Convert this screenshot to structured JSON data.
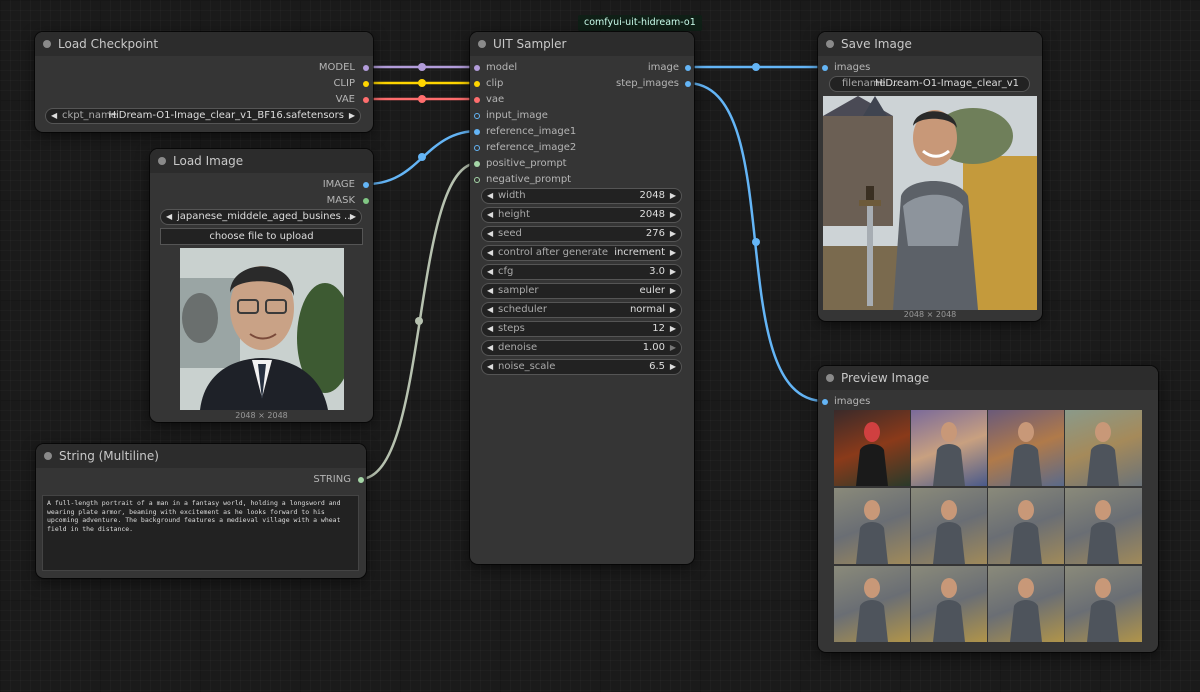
{
  "group": {
    "label": "comfyui-uit-hidream-o1"
  },
  "load_checkpoint": {
    "title": "Load Checkpoint",
    "outputs": [
      "MODEL",
      "CLIP",
      "VAE"
    ],
    "ckpt_label": "ckpt_name",
    "ckpt_value": "HiDream-O1-Image_clear_v1_BF16.safetensors"
  },
  "load_image": {
    "title": "Load Image",
    "outputs": [
      "IMAGE",
      "MASK"
    ],
    "file_value": "japanese_middele_aged_busines ...",
    "upload_label": "choose file to upload",
    "size_caption": "2048 × 2048"
  },
  "string_node": {
    "title": "String (Multiline)",
    "output": "STRING",
    "text": "A full-length portrait of a man in a fantasy world, holding a longsword and wearing plate armor, beaming with excitement as he looks forward to his upcoming adventure. The background features a medieval village with a wheat field in the distance."
  },
  "sampler": {
    "title": "UIT Sampler",
    "inputs": [
      "model",
      "clip",
      "vae",
      "input_image",
      "reference_image1",
      "reference_image2",
      "positive_prompt",
      "negative_prompt"
    ],
    "outputs": [
      "image",
      "step_images"
    ],
    "widgets": [
      {
        "label": "width",
        "value": "2048"
      },
      {
        "label": "height",
        "value": "2048"
      },
      {
        "label": "seed",
        "value": "276"
      },
      {
        "label": "control after generate",
        "value": "increment"
      },
      {
        "label": "cfg",
        "value": "3.0"
      },
      {
        "label": "sampler",
        "value": "euler"
      },
      {
        "label": "scheduler",
        "value": "normal"
      },
      {
        "label": "steps",
        "value": "12"
      },
      {
        "label": "denoise",
        "value": "1.00"
      },
      {
        "label": "noise_scale",
        "value": "6.5"
      }
    ]
  },
  "save_image": {
    "title": "Save Image",
    "input": "images",
    "filename_label": "filename ...",
    "filename_value": "HiDream-O1-Image_clear_v1",
    "size_caption": "2048 × 2048"
  },
  "preview_image": {
    "title": "Preview Image",
    "input": "images"
  },
  "colors": {
    "model": "#b39ddb",
    "clip": "#ffd500",
    "vae": "#ff6e6e",
    "image": "#64b5f6",
    "mask": "#81c784",
    "string": "#a5d6a7",
    "wire_string": "#b7c2b0"
  }
}
